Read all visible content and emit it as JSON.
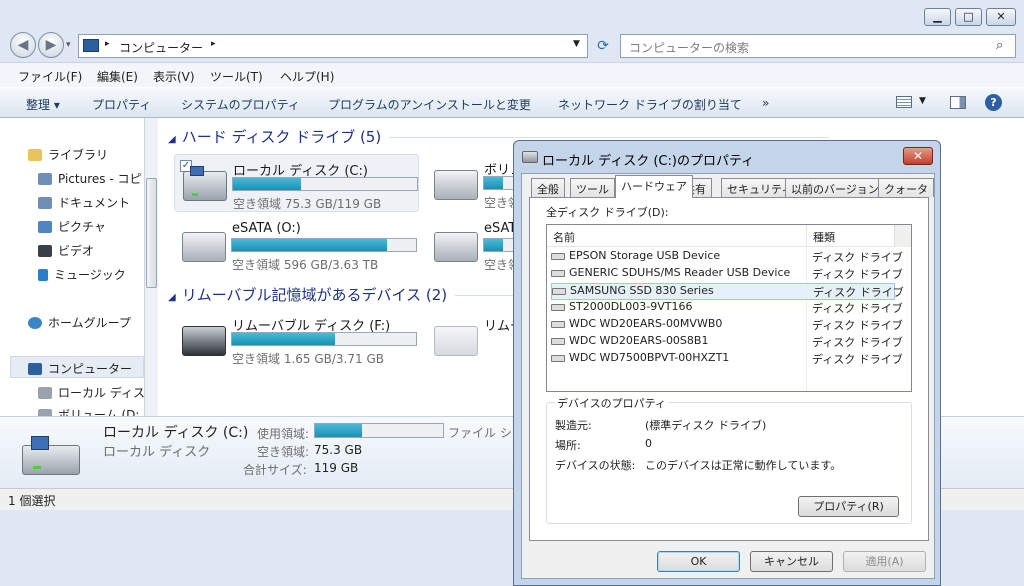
{
  "titlebar": {
    "min": "▁",
    "max": "□",
    "close": "✕"
  },
  "address": {
    "path_sep": "▸",
    "location": "コンピューター",
    "arrow": "▸",
    "search_placeholder": "コンピューターの検索"
  },
  "menu": [
    "ファイル(F)",
    "編集(E)",
    "表示(V)",
    "ツール(T)",
    "ヘルプ(H)"
  ],
  "toolbar": {
    "organize": "整理 ▾",
    "properties": "プロパティ",
    "system_properties": "システムのプロパティ",
    "uninstall": "プログラムのアンインストールと変更",
    "map_drive": "ネットワーク ドライブの割り当て",
    "more": "»"
  },
  "nav": {
    "libraries": "ライブラリ",
    "pictures_lib": "Pictures - コピ",
    "documents": "ドキュメント",
    "pictures": "ピクチャ",
    "videos": "ビデオ",
    "music": "ミュージック",
    "homegroup": "ホームグループ",
    "computer": "コンピューター",
    "local_disk": "ローカル ディス",
    "volume": "ボリューム (D:"
  },
  "groups": {
    "hdd": "ハード ディスク ドライブ (5)",
    "removable": "リムーバブル記憶域があるデバイス (2)"
  },
  "drives": [
    {
      "name": "ローカル ディスク (C:)",
      "free": "空き領域 75.3 GB/119 GB",
      "used_fraction": 0.37
    },
    {
      "name": "ボリュ",
      "free": "空き領",
      "used_fraction": 0.5
    },
    {
      "name": "eSATA (O:)",
      "free": "空き領域 596 GB/3.63 TB",
      "used_fraction": 0.84
    },
    {
      "name": "eSATA",
      "free": "空き領",
      "used_fraction": 0.5
    },
    {
      "name": "リムーバブル ディスク (F:)",
      "free": "空き領域 1.65 GB/3.71 GB",
      "used_fraction": 0.56
    },
    {
      "name": "リムー",
      "free": "",
      "used_fraction": 0
    }
  ],
  "details": {
    "name": "ローカル ディスク (C:)",
    "type": "ローカル ディスク",
    "used_label": "使用領域:",
    "free_label": "空き領域:",
    "free_value": "75.3 GB",
    "total_label": "合計サイズ:",
    "total_value": "119 GB",
    "fs_label": "ファイル シ",
    "used_fraction": 0.37
  },
  "status": "1 個選択",
  "dialog": {
    "title": "ローカル ディスク (C:)のプロパティ",
    "tabs": [
      "全般",
      "ツール",
      "ハードウェア",
      "共有",
      "セキュリティ",
      "以前のバージョン",
      "クォータ"
    ],
    "all_drives_label": "全ディスク ドライブ(D):",
    "col_name": "名前",
    "col_type": "種類",
    "devices": [
      {
        "name": "EPSON Storage USB Device",
        "type": "ディスク ドライブ"
      },
      {
        "name": "GENERIC SDUHS/MS Reader USB Device",
        "type": "ディスク ドライブ"
      },
      {
        "name": "SAMSUNG SSD 830 Series",
        "type": "ディスク ドライブ"
      },
      {
        "name": "ST2000DL003-9VT166",
        "type": "ディスク ドライブ"
      },
      {
        "name": "WDC WD20EARS-00MVWB0",
        "type": "ディスク ドライブ"
      },
      {
        "name": "WDC WD20EARS-00S8B1",
        "type": "ディスク ドライブ"
      },
      {
        "name": "WDC WD7500BPVT-00HXZT1",
        "type": "ディスク ドライブ"
      }
    ],
    "device_props": "デバイスのプロパティ",
    "manufacturer_label": "製造元:",
    "manufacturer": "(標準ディスク ドライブ)",
    "location_label": "場所:",
    "location": "0",
    "state_label": "デバイスの状態:",
    "state": "このデバイスは正常に動作しています。",
    "properties_btn": "プロパティ(R)",
    "ok": "OK",
    "cancel": "キャンセル",
    "apply": "適用(A)"
  }
}
